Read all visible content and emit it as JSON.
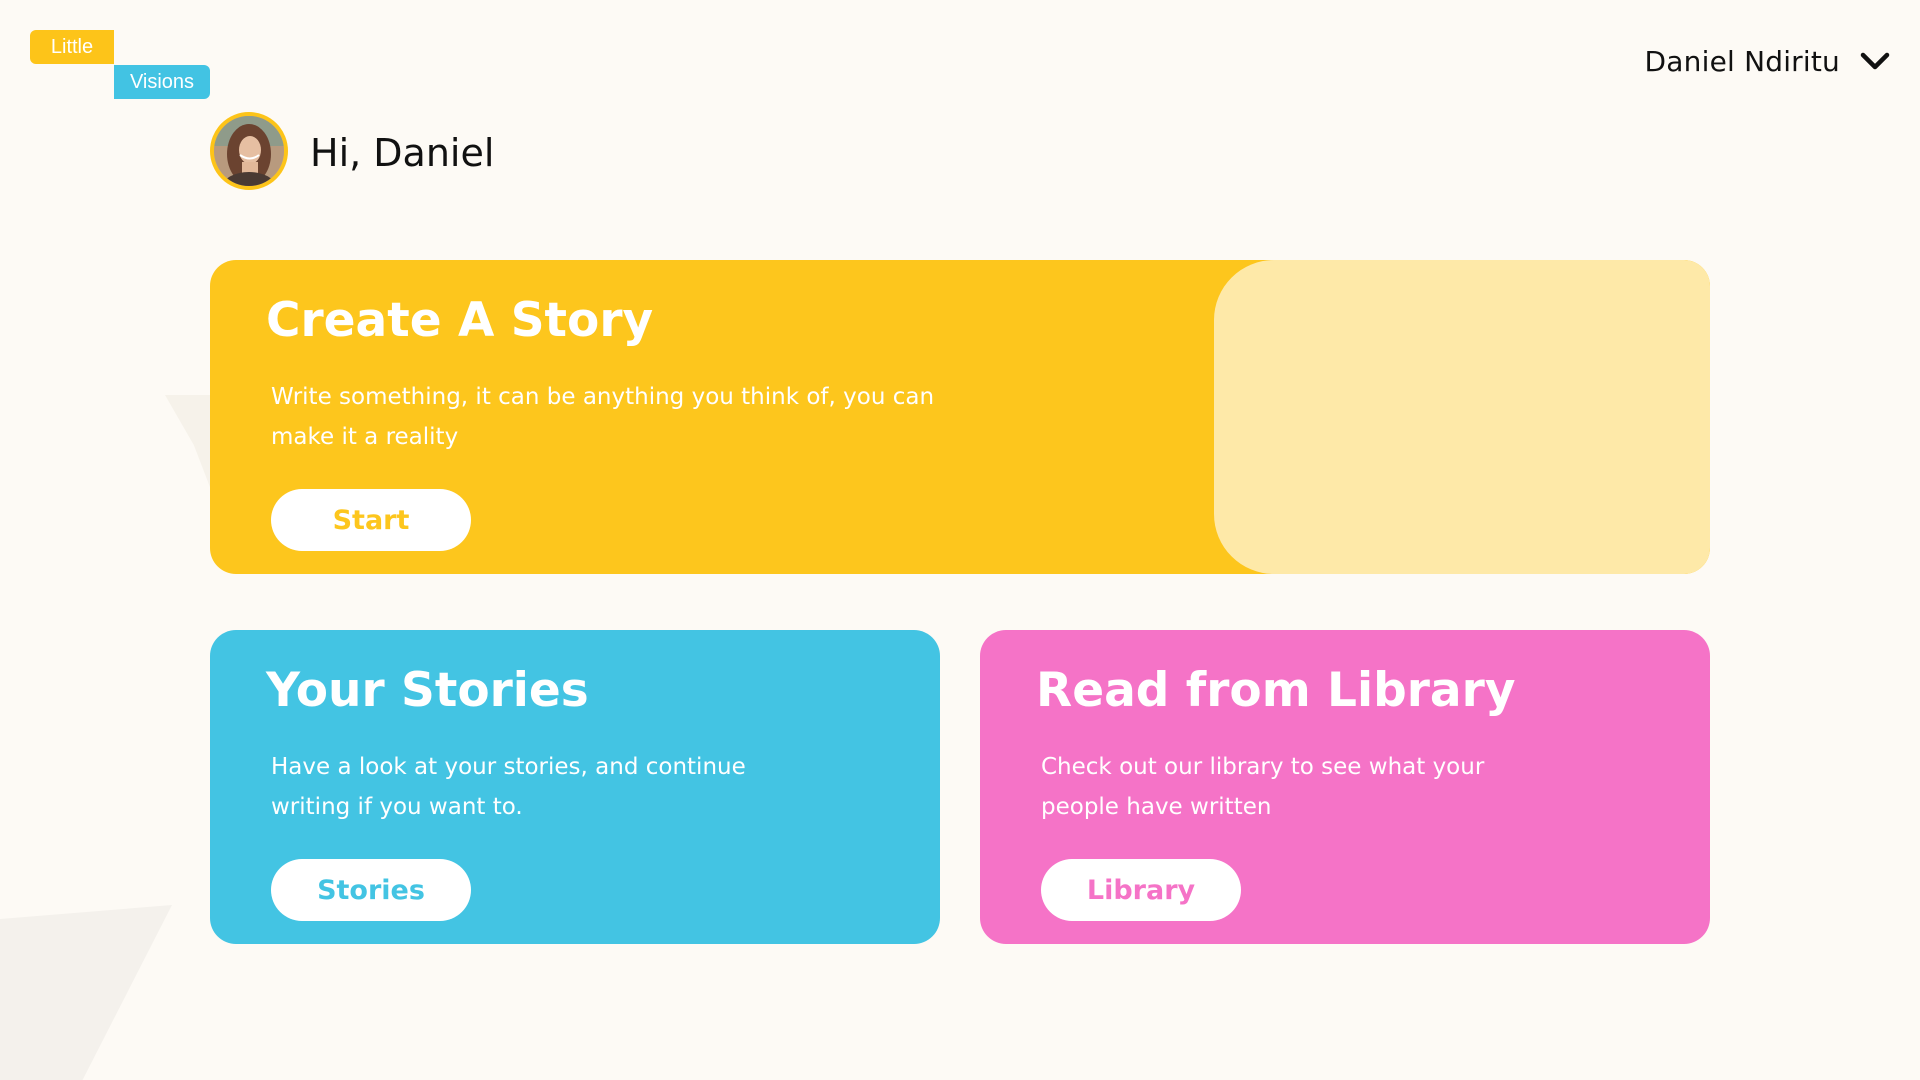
{
  "logo": {
    "line1": "Little",
    "line2": "Visions"
  },
  "user_menu": {
    "name": "Daniel Ndiritu",
    "icon": "chevron-down-icon"
  },
  "greeting": {
    "text": "Hi, Daniel",
    "avatar": "user-avatar"
  },
  "cards": {
    "create": {
      "title": "Create A Story",
      "description": "Write something, it can be anything you think of, you can make it a reality",
      "button_label": "Start"
    },
    "stories": {
      "title": "Your Stories",
      "description": "Have a look at your stories, and continue writing if you want to.",
      "button_label": "Stories"
    },
    "library": {
      "title": "Read from Library",
      "description": "Check out our library to see what your people have written",
      "button_label": "Library"
    }
  },
  "colors": {
    "background": "#fdfaf5",
    "yellow": "#fdc61d",
    "yellow_light": "#fee9a8",
    "blue": "#43c4e3",
    "pink": "#f573c7"
  }
}
